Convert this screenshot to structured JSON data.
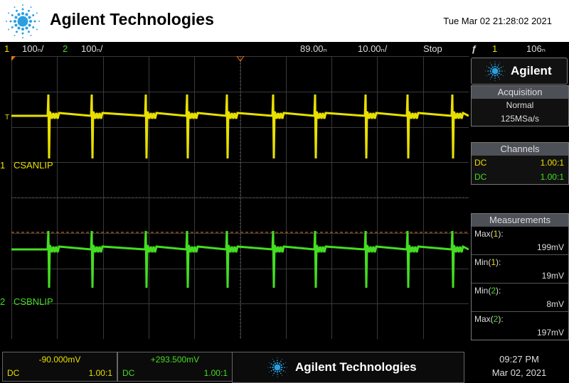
{
  "header": {
    "brand": "Agilent Technologies",
    "datetime": "Tue Mar 02 21:28:02 2021"
  },
  "status_bar": {
    "ch1_num": "1",
    "ch1_scale": "100ₙ/",
    "ch2_num": "2",
    "ch2_scale": "100ₙ/",
    "delay": "89.00ₙ",
    "timebase": "10.00ₙ/",
    "run_state": "Stop",
    "trigger_icon": "ƒ",
    "trigger_source": "1",
    "trigger_level": "106ₙ"
  },
  "waveform": {
    "ch1_label": "CSANLIP",
    "ch2_label": "CSBNLIP",
    "ch1_marker": "1",
    "ch2_marker": "2",
    "trigger_marker": "T"
  },
  "side_panel": {
    "brand": "Agilent",
    "acquisition": {
      "title": "Acquisition",
      "mode": "Normal",
      "rate": "125MSa/s"
    },
    "channels": {
      "title": "Channels",
      "rows": [
        {
          "coupling": "DC",
          "probe": "1.00:1"
        },
        {
          "coupling": "DC",
          "probe": "1.00:1"
        }
      ]
    },
    "measurements": {
      "title": "Measurements",
      "items": [
        {
          "name": "Max(",
          "ch": "1",
          "close": "):",
          "value": "199mV"
        },
        {
          "name": "Min(",
          "ch": "1",
          "close": "):",
          "value": "19mV"
        },
        {
          "name": "Min(",
          "ch": "2",
          "close": "):",
          "value": "8mV"
        },
        {
          "name": "Max(",
          "ch": "2",
          "close": "):",
          "value": "197mV"
        }
      ]
    }
  },
  "footer": {
    "ch1": {
      "offset": "-90.000mV",
      "coupling": "DC",
      "probe": "1.00:1"
    },
    "ch2": {
      "offset": "+293.500mV",
      "coupling": "DC",
      "probe": "1.00:1"
    },
    "brand": "Agilent Technologies",
    "time": "09:27 PM",
    "date": "Mar 02, 2021"
  },
  "colors": {
    "ch1": "#e8e000",
    "ch2": "#44dd22",
    "grid": "#3a3a3a",
    "trigger_line": "#e8731a",
    "accent_blue": "#2b9fe0"
  }
}
